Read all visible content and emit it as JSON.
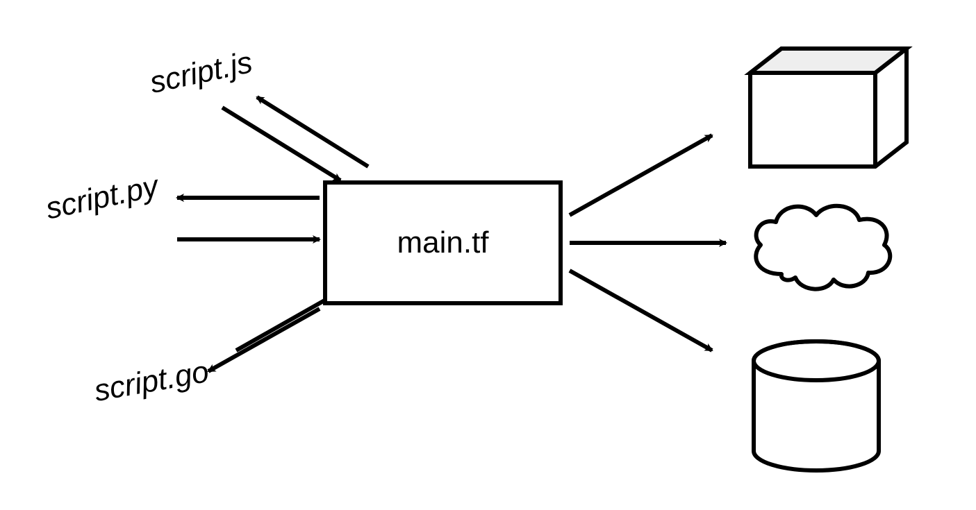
{
  "scripts": {
    "js": "script.js",
    "py": "script.py",
    "go": "script.go"
  },
  "main": {
    "label": "main.tf"
  },
  "resources": {
    "top": "cube",
    "middle": "cloud",
    "bottom": "cylinder"
  }
}
